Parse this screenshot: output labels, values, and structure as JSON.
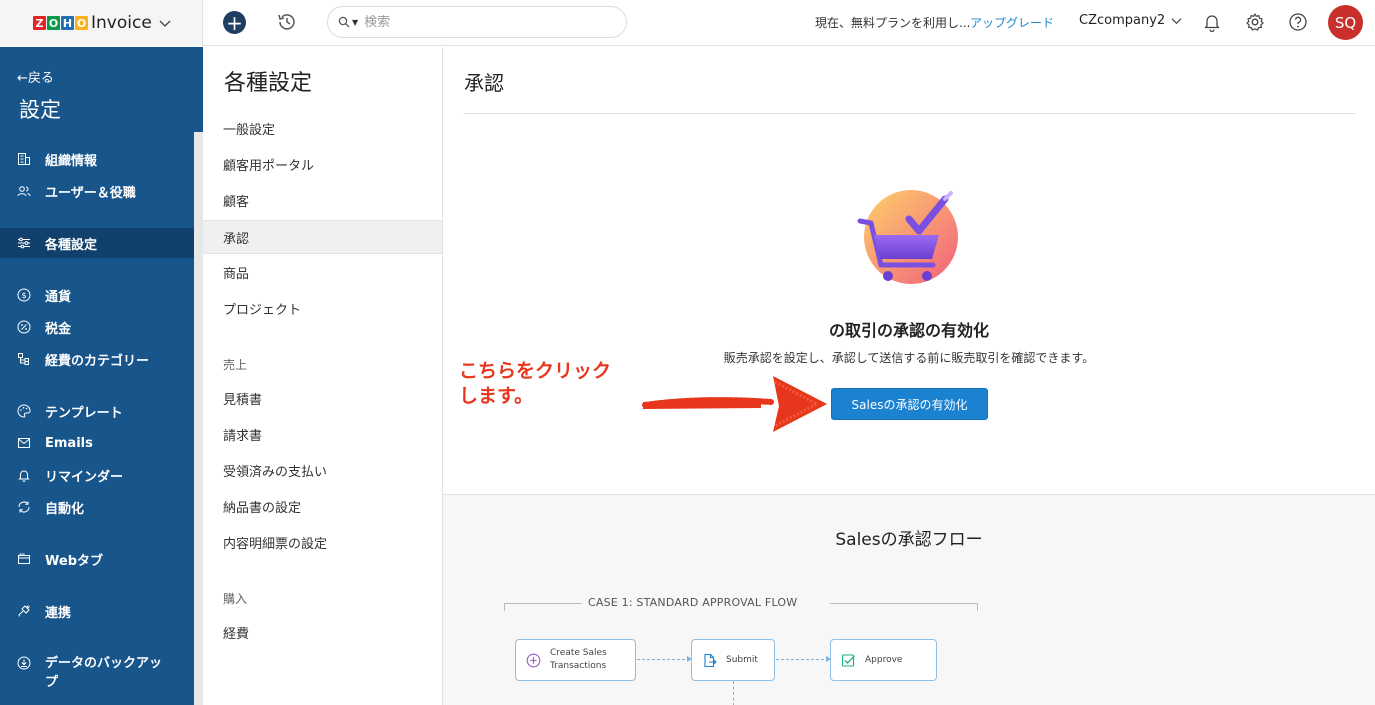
{
  "colors": {
    "sidebar_bg": "#18558a",
    "sidebar_active": "#11406c",
    "primary_button": "#1a82d0",
    "link": "#1e88d0",
    "avatar_bg": "#c9302c",
    "callout": "#e8361c",
    "zoho_z": "#e42527",
    "zoho_o1": "#089949",
    "zoho_h": "#226db4",
    "zoho_o2": "#f9b21d"
  },
  "topbar": {
    "zoho_letters": [
      "Z",
      "O",
      "H",
      "O"
    ],
    "product_name": "Invoice",
    "search_placeholder": "検索",
    "plan_text": "現在、無料プランを利用し...",
    "upgrade_label": "アップグレード",
    "org_name": "CZcompany2",
    "avatar_initials": "SQ"
  },
  "sidebar": {
    "back_label": "←戻る",
    "title": "設定",
    "items": [
      {
        "label": "組織情報",
        "icon": "building-icon"
      },
      {
        "label": "ユーザー＆役職",
        "icon": "users-icon"
      },
      {
        "label": "各種設定",
        "icon": "sliders-icon"
      },
      {
        "label": "通貨",
        "icon": "currency-icon"
      },
      {
        "label": "税金",
        "icon": "tax-icon"
      },
      {
        "label": "経費のカテゴリー",
        "icon": "category-icon"
      },
      {
        "label": "テンプレート",
        "icon": "palette-icon"
      },
      {
        "label": "Emails",
        "icon": "email-icon"
      },
      {
        "label": "リマインダー",
        "icon": "bell-icon"
      },
      {
        "label": "自動化",
        "icon": "refresh-icon"
      },
      {
        "label": "Webタブ",
        "icon": "webtab-icon"
      },
      {
        "label": "連携",
        "icon": "plug-icon"
      },
      {
        "label": "データのバックアッ\nプ",
        "icon": "backup-icon"
      }
    ]
  },
  "settings_list": {
    "title": "各種設定",
    "items": [
      "一般設定",
      "顧客用ポータル",
      "顧客",
      "承認",
      "商品",
      "プロジェクト"
    ],
    "sales_section": "売上",
    "sales_items": [
      "見積書",
      "請求書",
      "受領済みの支払い",
      "納品書の設定",
      "内容明細票の設定"
    ],
    "purchase_section": "購入",
    "purchase_items": [
      "経費"
    ]
  },
  "main": {
    "title": "承認",
    "enable_heading": "の取引の承認の有効化",
    "enable_description": "販売承認を設定し、承認して送信する前に販売取引を確認できます。",
    "enable_button": "Salesの承認の有効化",
    "callout_text": "こちらをクリック\nします。",
    "flow_title": "Salesの承認フロー",
    "case_label": "CASE 1: STANDARD APPROVAL FLOW",
    "flow_steps": [
      "Create Sales\nTransactions",
      "Submit",
      "Approve"
    ]
  }
}
